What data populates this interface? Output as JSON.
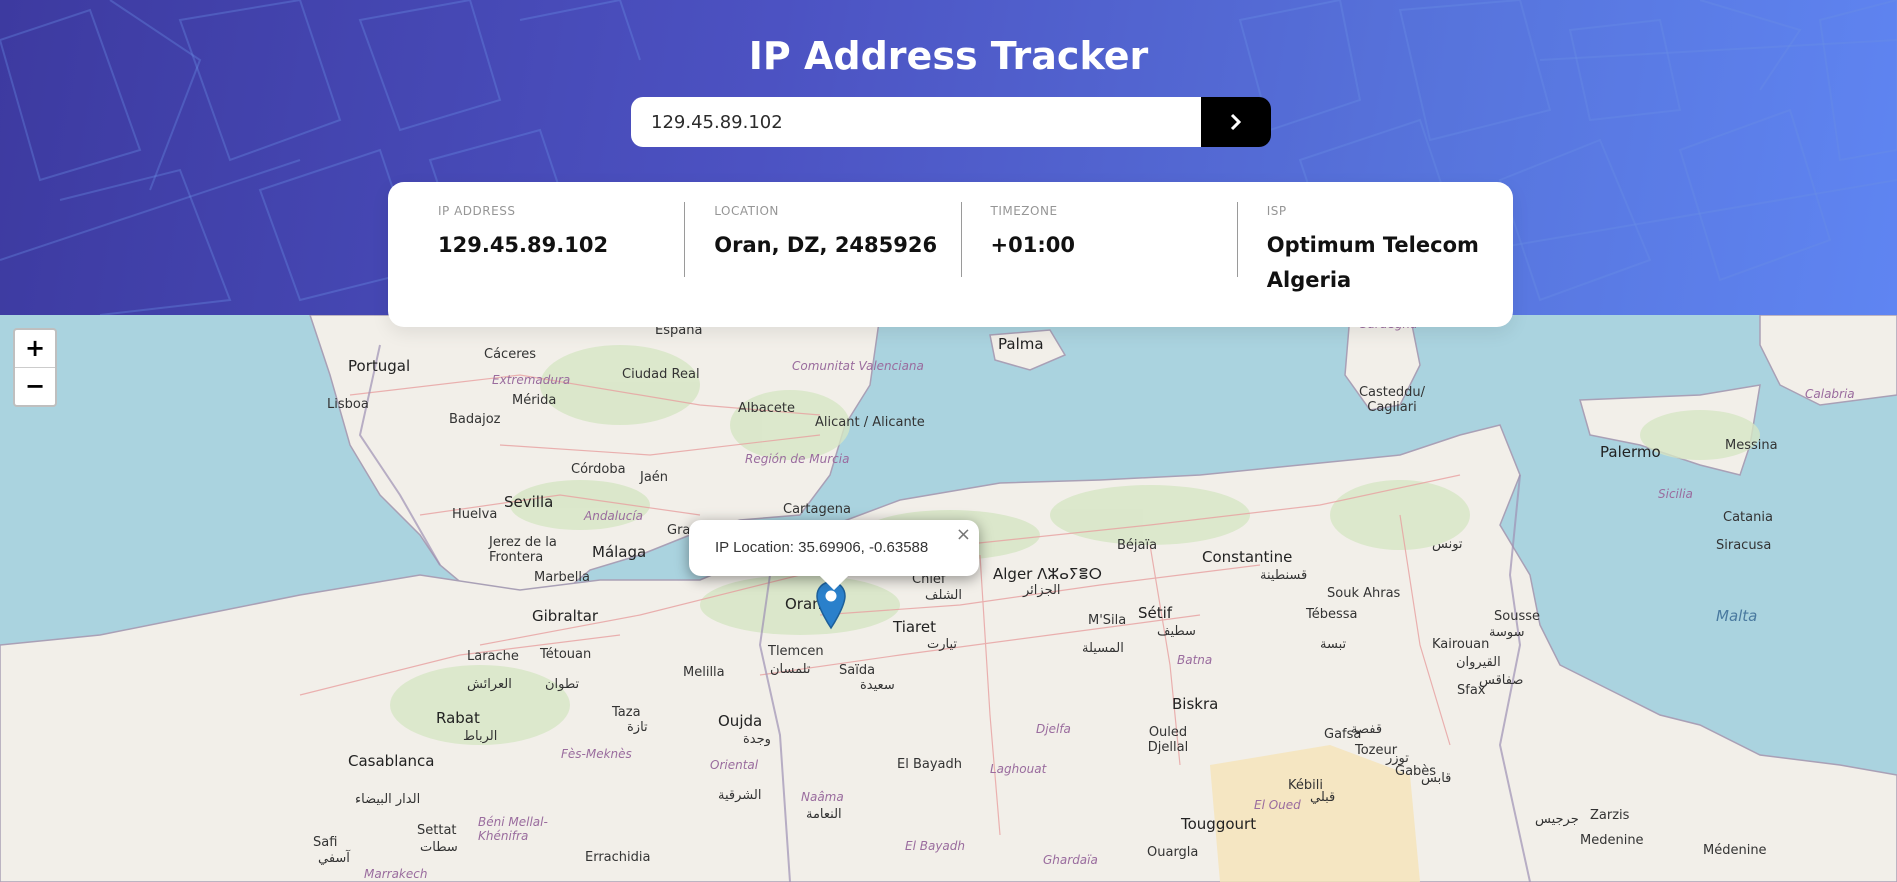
{
  "header": {
    "title": "IP Address Tracker"
  },
  "search": {
    "value": "129.45.89.102",
    "button_icon": "chevron-right-icon"
  },
  "info": {
    "ip_label": "IP ADDRESS",
    "ip_value": "129.45.89.102",
    "location_label": "LOCATION",
    "location_value": "Oran, DZ, 2485926",
    "timezone_label": "TIMEZONE",
    "timezone_value": "+01:00",
    "isp_label": "ISP",
    "isp_value": "Optimum Telecom Algeria"
  },
  "map": {
    "zoom_in": "+",
    "zoom_out": "−",
    "popup_text": "IP Location: 35.69906, -0.63588",
    "popup_close": "×",
    "places": [
      "España",
      "Portugal",
      "Cáceres",
      "Extremadura",
      "Mérida",
      "Ciudad Real",
      "Comunitat Valenciana",
      "Lisboa",
      "Badajoz",
      "Albacete",
      "Alicant / Alicante",
      "Región de Murcia",
      "Córdoba",
      "Jaén",
      "Sevilla",
      "Huelva",
      "Andalucía",
      "Cartagena",
      "Jerez de la Frontera",
      "Málaga",
      "Gra",
      "Marbella",
      "Gibraltar",
      "Palma",
      "Casteddu/ Cagliari",
      "Palermo",
      "Messina",
      "Sicilia",
      "Catania",
      "Siracusa",
      "Malta",
      "Calabria",
      "Sardegna",
      "Alger ⴷⵣⴰⵢⴻⵔ",
      "الجزائر",
      "Béjaïa",
      "Constantine",
      "قسنطينة",
      "تونس",
      "Souk Ahras",
      "Tébessa",
      "تبسة",
      "Sétif",
      "سطيف",
      "M'Sila",
      "المسيلة",
      "Batna",
      "Chlef",
      "الشلف",
      "Oran",
      "Tiaret",
      "تيارت",
      "Tlemcen",
      "تلمسان",
      "Saïda",
      "سعيدة",
      "Melilla",
      "Tétouan",
      "تطوان",
      "Larache",
      "العرائش",
      "Taza",
      "تازة",
      "Oujda",
      "وجدة",
      "Rabat",
      "الرباط",
      "Casablanca",
      "الدار البيضاء",
      "Fès-Meknès",
      "Oriental",
      "الشرقية",
      "Naâma",
      "النعامة",
      "El Bayadh",
      "Laghouat",
      "Djelfa",
      "Biskra",
      "Ouled Djellal",
      "Tébessa",
      "Kairouan",
      "القيروان",
      "Sousse",
      "سوسة",
      "Sfax",
      "صفاقس",
      "Gafsa",
      "قفصة",
      "Tozeur",
      "توزر",
      "Kébili",
      "قبلي",
      "Gabès",
      "قابس",
      "Touggourt",
      "El Oued",
      "Ouargla",
      "Ghardaïa",
      "El Bayadh",
      "Errachidia",
      "Settat",
      "سطات",
      "Safi",
      "آسفي",
      "Béni Mellal-Khénifra",
      "Marrakech",
      "Zarzis",
      "جرجيس",
      "Medenine",
      "Médenine"
    ]
  }
}
